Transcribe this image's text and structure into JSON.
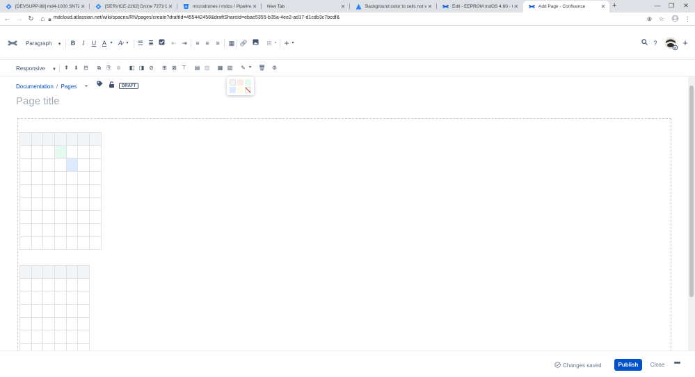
{
  "browser": {
    "tabs": [
      {
        "title": "[DEVSUPP-88] md4-1000 SN727...",
        "icon": "jira-icon"
      },
      {
        "title": "[SERVICE-2262] Drone 7273 Cra...",
        "icon": "jira-icon"
      },
      {
        "title": "microdrones / mdos / Pipelines ...",
        "icon": "bitbucket-icon"
      },
      {
        "title": "New Tab",
        "icon": ""
      },
      {
        "title": "Background color to cells not via...",
        "icon": "atlassian-icon"
      },
      {
        "title": "Edit - EEPROM mdOS 4.60 - Con...",
        "icon": "confluence-icon"
      },
      {
        "title": "Add Page - Confluence",
        "icon": "confluence-icon"
      }
    ],
    "new_tab": "+",
    "url": "mdcloud.atlassian.net/wiki/spaces/RN/pages/create?draftId=455442458&draftShareId=ebae5355-b35a-4ee2-ad17-d1cdb3c7bcdf&"
  },
  "toolbar": {
    "text_style": "Paragraph",
    "layout_mode": "Responsive"
  },
  "page": {
    "breadcrumb_space": "Documentation",
    "breadcrumb_separator": "/",
    "breadcrumb_pages": "Pages",
    "status_badge": "DRAFT",
    "title_placeholder": "Page title"
  },
  "tables": [
    {
      "rows": 9,
      "cols": 7,
      "highlights": [
        {
          "row": 1,
          "col": 3,
          "color": "#e3fcef"
        },
        {
          "row": 2,
          "col": 4,
          "color": "#deebff"
        }
      ]
    },
    {
      "rows": 7,
      "cols": 6,
      "highlights": []
    }
  ],
  "color_picker": {
    "swatches": [
      "#f4f5f7",
      "#ffebe6",
      "#e3fcef",
      "#deebff",
      "#fffae6",
      "none"
    ]
  },
  "footer": {
    "saved_status": "Changes saved",
    "publish_label": "Publish",
    "close_label": "Close",
    "more_label": "•••"
  },
  "colors": {
    "accent": "#0052cc",
    "tab_strip": "#dee1e6"
  }
}
